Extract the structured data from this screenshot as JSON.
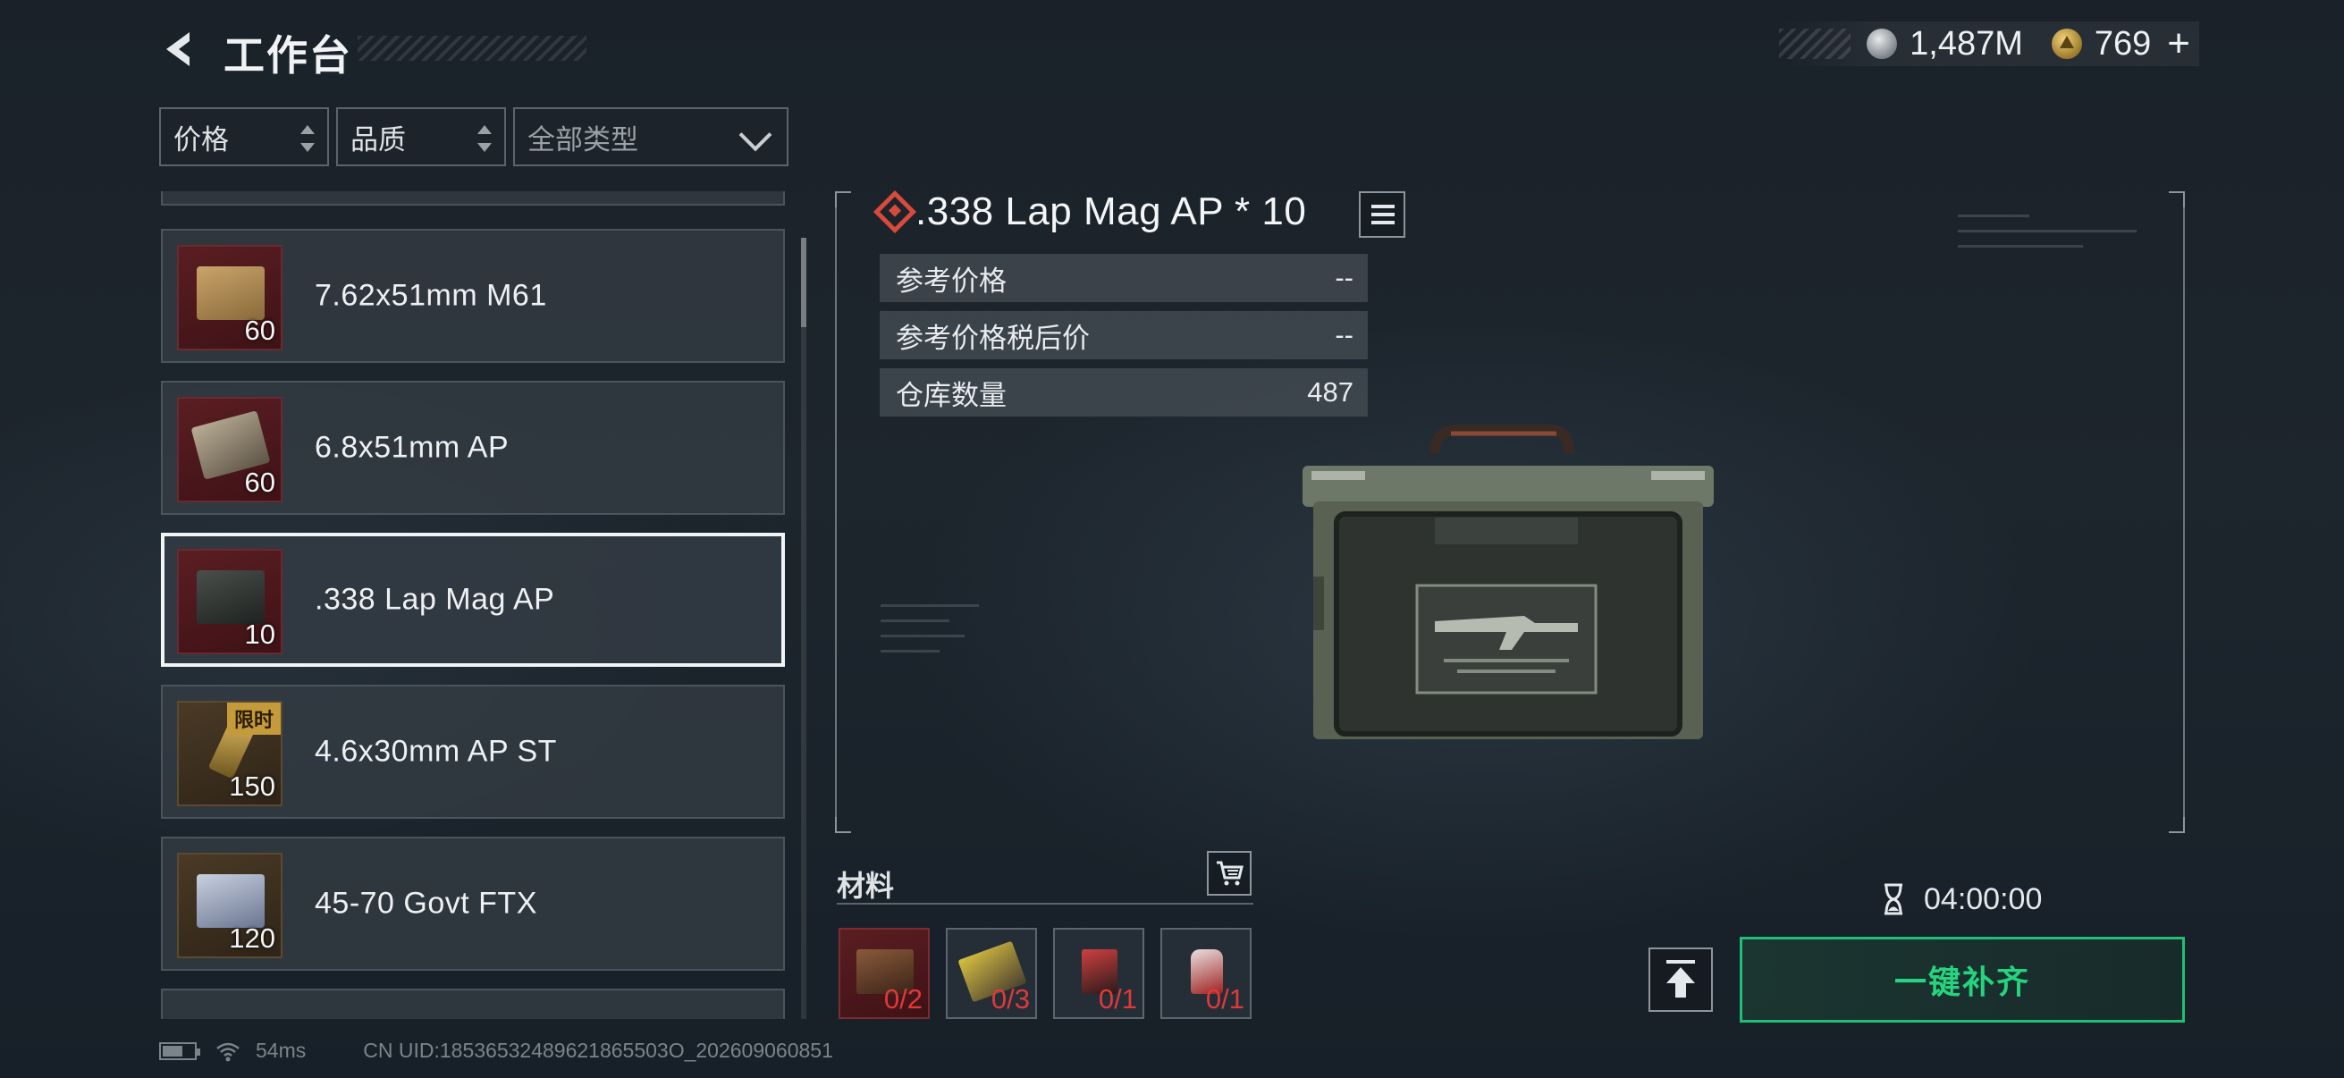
{
  "header": {
    "title": "工作台",
    "currency_1": {
      "icon": "silver-coin-icon",
      "value": "1,487M"
    },
    "currency_2": {
      "icon": "gold-coin-icon",
      "value": "769"
    },
    "add_label": "+"
  },
  "filters": {
    "price": "价格",
    "quality": "品质",
    "type": "全部类型"
  },
  "items": [
    {
      "name": "7.62x51mm M61",
      "qty": "60",
      "badge": "",
      "selected": false
    },
    {
      "name": "6.8x51mm AP",
      "qty": "60",
      "badge": "",
      "selected": false
    },
    {
      "name": ".338 Lap Mag AP",
      "qty": "10",
      "badge": "",
      "selected": true
    },
    {
      "name": "4.6x30mm AP ST",
      "qty": "150",
      "badge": "限时",
      "selected": false
    },
    {
      "name": "45-70 Govt FTX",
      "qty": "120",
      "badge": "",
      "selected": false
    }
  ],
  "detail": {
    "title": ".338 Lap Mag AP * 10",
    "stats": [
      {
        "label": "参考价格",
        "value": "--"
      },
      {
        "label": "参考价格税后价",
        "value": "--"
      },
      {
        "label": "仓库数量",
        "value": "487"
      }
    ]
  },
  "materials": {
    "label": "材料",
    "items": [
      {
        "count": "0/2"
      },
      {
        "count": "0/3"
      },
      {
        "count": "0/1"
      },
      {
        "count": "0/1"
      }
    ]
  },
  "craft": {
    "timer": "04:00:00",
    "fill_button": "一键补齐"
  },
  "footer": {
    "ping": "54ms",
    "uid": "CN UID:18536532489621865503O_202609060851"
  },
  "colors": {
    "accent_green": "#1fbf74",
    "material_missing_red": "#e0393a",
    "rarity_diamond_red": "#d94a3c"
  }
}
